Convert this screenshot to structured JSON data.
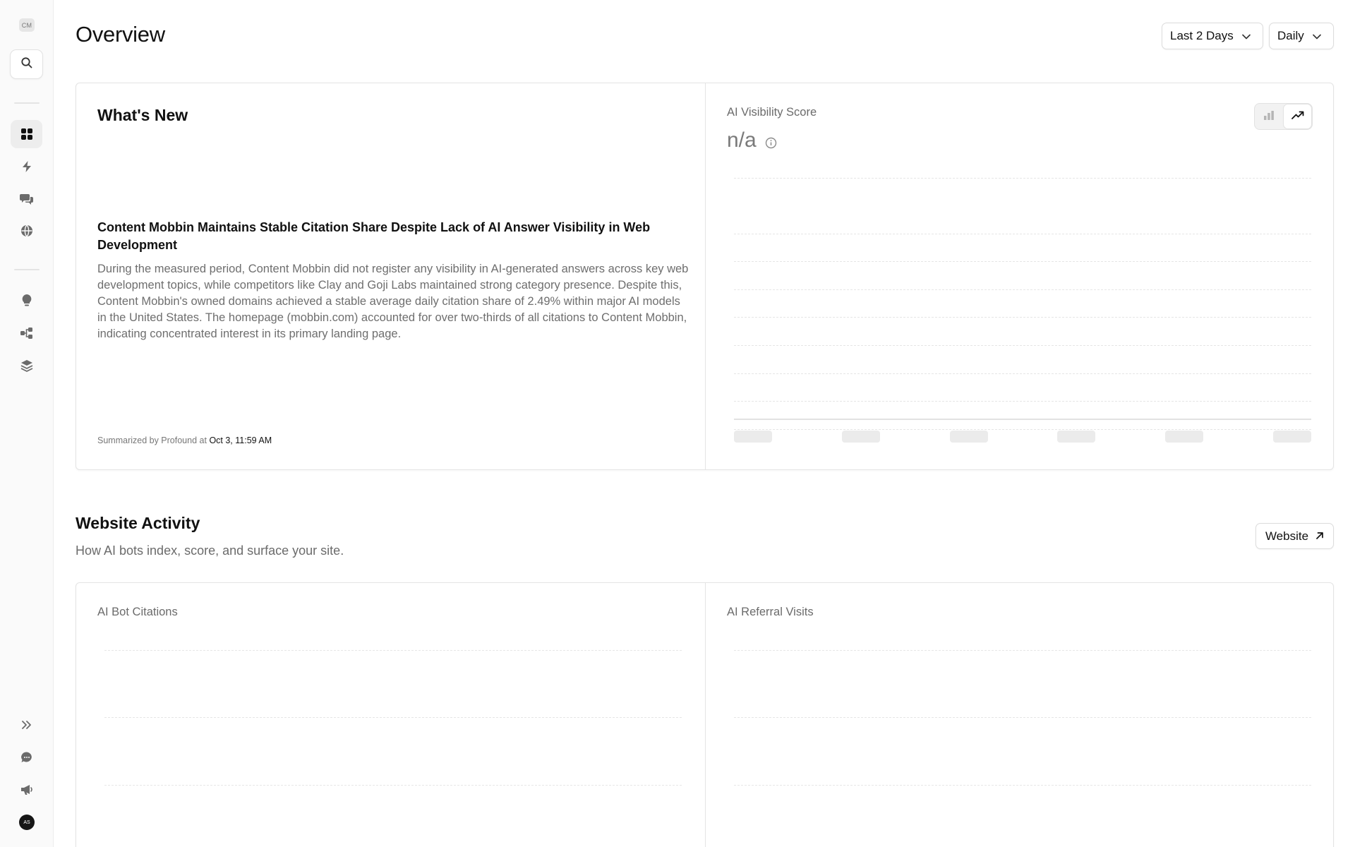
{
  "sidebar": {
    "workspace_initials": "CM",
    "user_initials": "AS",
    "items": [
      {
        "name": "dashboard",
        "icon": "grid-icon",
        "active": true
      },
      {
        "name": "actions",
        "icon": "lightning-icon",
        "active": false
      },
      {
        "name": "conversations",
        "icon": "chat-bubbles-icon",
        "active": false
      },
      {
        "name": "web",
        "icon": "globe-icon",
        "active": false
      },
      {
        "name": "insights",
        "icon": "lightbulb-icon",
        "active": false
      },
      {
        "name": "workflows",
        "icon": "hierarchy-icon",
        "active": false
      },
      {
        "name": "layers",
        "icon": "layers-icon",
        "active": false
      }
    ],
    "bottom_items": [
      {
        "name": "expand",
        "icon": "double-chevron-right-icon"
      },
      {
        "name": "support-chat",
        "icon": "chat-icon"
      },
      {
        "name": "announcements",
        "icon": "megaphone-icon"
      }
    ]
  },
  "header": {
    "title": "Overview",
    "range_label": "Last 2 Days",
    "frequency_label": "Daily"
  },
  "whats_new": {
    "title": "What's New",
    "headline": "Content Mobbin Maintains Stable Citation Share Despite Lack of AI Answer Visibility in Web Development",
    "body": "During the measured period, Content Mobbin did not register any visibility in AI-generated answers across key web development topics, while competitors like Clay and Goji Labs maintained strong category presence. Despite this, Content Mobbin's owned domains achieved a stable average daily citation share of 2.49% within major AI models in the United States. The homepage (mobbin.com) accounted for over two-thirds of all citations to Content Mobbin, indicating concentrated interest in its primary landing page.",
    "summary_prefix": "Summarized by Profound at",
    "summary_timestamp": "Oct 3, 11:59 AM"
  },
  "visibility": {
    "label": "AI Visibility Score",
    "value": "n/a",
    "view_mode": "line"
  },
  "website_activity": {
    "title": "Website Activity",
    "subtitle": "How AI bots index, score, and surface your site.",
    "button_label": "Website",
    "citations_label": "AI Bot Citations",
    "referrals_label": "AI Referral Visits"
  },
  "colors": {
    "accent": "#111111",
    "muted_text": "#6b6b6b",
    "border": "#e4e4e4",
    "sidebar_bg": "#fafafa"
  }
}
